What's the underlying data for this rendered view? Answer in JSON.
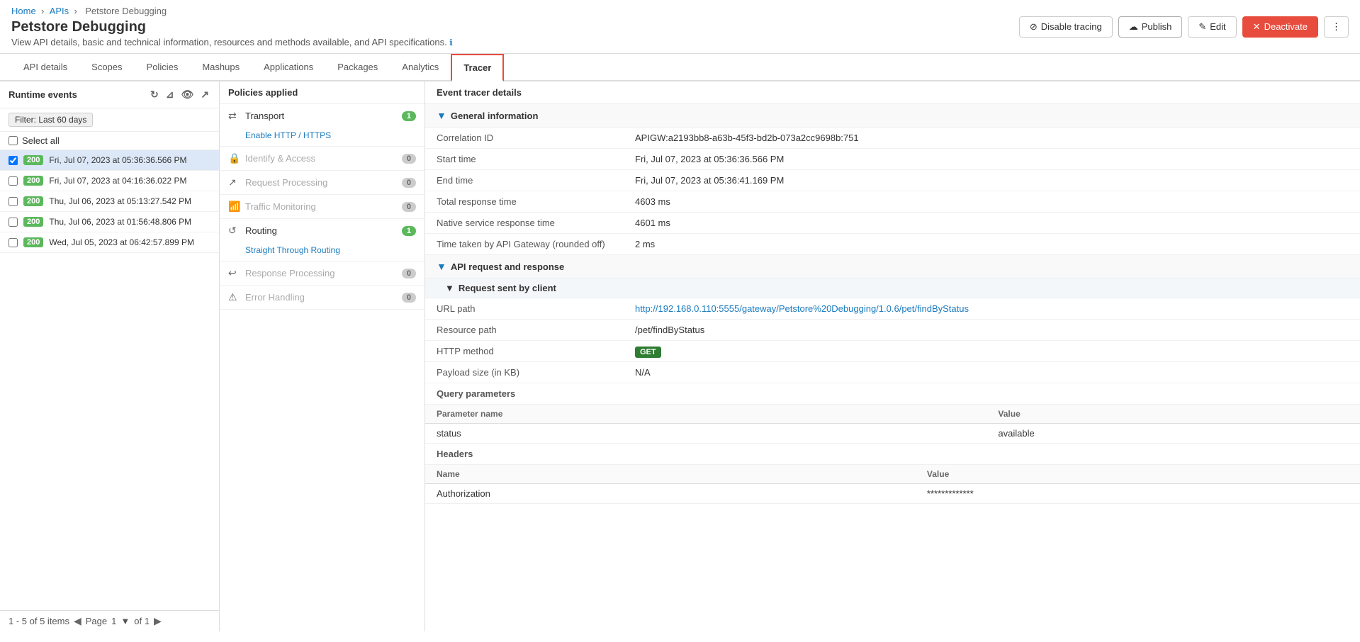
{
  "breadcrumb": {
    "home": "Home",
    "apis": "APIs",
    "current": "Petstore Debugging"
  },
  "page": {
    "title": "Petstore Debugging",
    "subtitle": "View API details, basic and technical information, resources and methods available, and API specifications.",
    "info_icon": "ℹ"
  },
  "header_actions": {
    "disable_tracing": "Disable tracing",
    "publish": "Publish",
    "edit": "Edit",
    "deactivate": "Deactivate"
  },
  "nav_tabs": [
    {
      "id": "api-details",
      "label": "API details",
      "active": false
    },
    {
      "id": "scopes",
      "label": "Scopes",
      "active": false
    },
    {
      "id": "policies",
      "label": "Policies",
      "active": false
    },
    {
      "id": "mashups",
      "label": "Mashups",
      "active": false
    },
    {
      "id": "applications",
      "label": "Applications",
      "active": false
    },
    {
      "id": "packages",
      "label": "Packages",
      "active": false
    },
    {
      "id": "analytics",
      "label": "Analytics",
      "active": false
    },
    {
      "id": "tracer",
      "label": "Tracer",
      "active": true
    }
  ],
  "left_panel": {
    "title": "Runtime events",
    "filter_label": "Filter: Last 60 days",
    "select_all": "Select all",
    "events": [
      {
        "status": "200",
        "time": "Fri, Jul 07, 2023 at 05:36:36.566 PM",
        "selected": true
      },
      {
        "status": "200",
        "time": "Fri, Jul 07, 2023 at 04:16:36.022 PM",
        "selected": false
      },
      {
        "status": "200",
        "time": "Thu, Jul 06, 2023 at 05:13:27.542 PM",
        "selected": false
      },
      {
        "status": "200",
        "time": "Thu, Jul 06, 2023 at 01:56:48.806 PM",
        "selected": false
      },
      {
        "status": "200",
        "time": "Wed, Jul 05, 2023 at 06:42:57.899 PM",
        "selected": false
      }
    ],
    "footer": {
      "count": "1 - 5 of 5 items",
      "page_label": "Page",
      "page_num": "1",
      "page_of": "of 1"
    }
  },
  "middle_panel": {
    "title": "Policies applied",
    "sections": [
      {
        "name": "Transport",
        "icon": "🚌",
        "count": 1,
        "sub": "Enable HTTP / HTTPS",
        "disabled": false
      },
      {
        "name": "Identify & Access",
        "icon": "🔒",
        "count": 0,
        "sub": null,
        "disabled": true
      },
      {
        "name": "Request Processing",
        "icon": "↗",
        "count": 0,
        "sub": null,
        "disabled": true
      },
      {
        "name": "Traffic Monitoring",
        "icon": "📊",
        "count": 0,
        "sub": null,
        "disabled": true
      },
      {
        "name": "Routing",
        "icon": "🔄",
        "count": 1,
        "sub": "Straight Through Routing",
        "disabled": false
      },
      {
        "name": "Response Processing",
        "icon": "↩",
        "count": 0,
        "sub": null,
        "disabled": true
      },
      {
        "name": "Error Handling",
        "icon": "⚠",
        "count": 0,
        "sub": null,
        "disabled": true
      }
    ]
  },
  "right_panel": {
    "title": "Event tracer details",
    "general_info": {
      "label": "General information",
      "fields": [
        {
          "name": "Correlation ID",
          "value": "APIGW:a2193bb8-a63b-45f3-bd2b-073a2cc9698b:751"
        },
        {
          "name": "Start time",
          "value": "Fri, Jul 07, 2023 at 05:36:36.566 PM"
        },
        {
          "name": "End time",
          "value": "Fri, Jul 07, 2023 at 05:36:41.169 PM"
        },
        {
          "name": "Total response time",
          "value": "4603 ms"
        },
        {
          "name": "Native service response time",
          "value": "4601 ms"
        },
        {
          "name": "Time taken by API Gateway (rounded off)",
          "value": "2 ms"
        }
      ]
    },
    "api_request_response": {
      "label": "API request and response",
      "request_sent_by_client": {
        "label": "Request sent by client",
        "fields": [
          {
            "name": "URL path",
            "value": "http://192.168.0.110:5555/gateway/Petstore%20Debugging/1.0.6/pet/findByStatus",
            "is_link": true
          },
          {
            "name": "Resource path",
            "value": "/pet/findByStatus"
          },
          {
            "name": "HTTP method",
            "value": "GET",
            "is_badge": true
          },
          {
            "name": "Payload size (in KB)",
            "value": "N/A"
          }
        ],
        "query_params": {
          "label": "Query parameters",
          "headers": [
            "Parameter name",
            "Value"
          ],
          "rows": [
            {
              "name": "status",
              "value": "available"
            }
          ]
        },
        "headers": {
          "label": "Headers",
          "columns": [
            "Name",
            "Value"
          ],
          "rows": [
            {
              "name": "Authorization",
              "value": "*************"
            }
          ]
        }
      }
    }
  }
}
